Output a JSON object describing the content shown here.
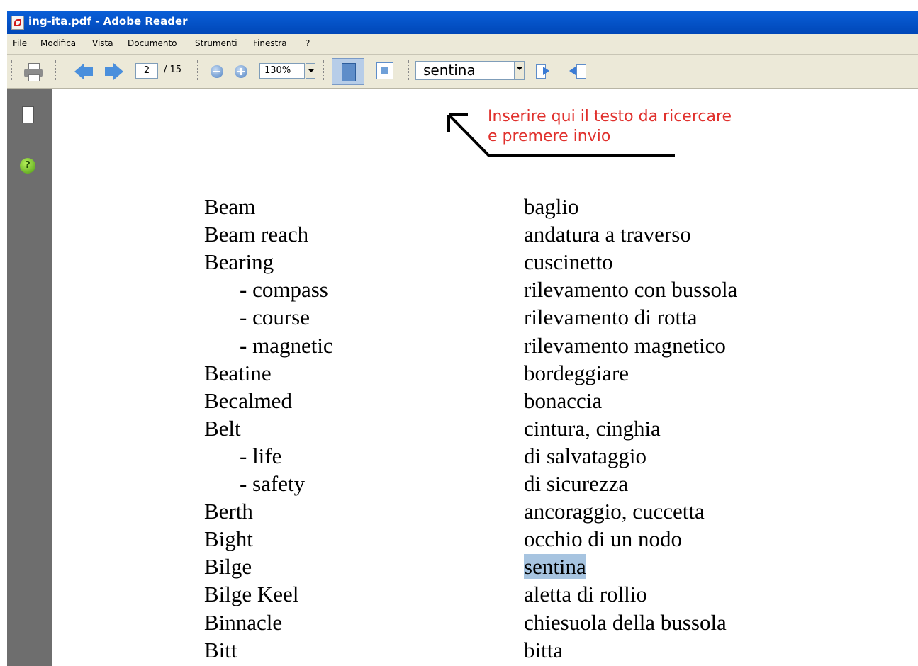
{
  "window": {
    "title": "ing-ita.pdf - Adobe Reader"
  },
  "menu": [
    "File",
    "Modifica",
    "Vista",
    "Documento",
    "Strumenti",
    "Finestra",
    "?"
  ],
  "toolbar": {
    "page_current": "2",
    "page_total": "/ 15",
    "zoom": "130%",
    "search_value": "sentina"
  },
  "icons": [
    "print-icon",
    "previous-page-icon",
    "next-page-icon",
    "zoom-out-icon",
    "zoom-in-icon",
    "fit-page-icon",
    "fit-window-icon",
    "find-previous-icon",
    "find-next-icon",
    "pages-icon",
    "help-icon"
  ],
  "annotation": {
    "line1": "Inserire qui il testo da ricercare",
    "line2": "e premere invio",
    "color": "#e0302c"
  },
  "highlight_color": "#a7c4e0",
  "glossary": [
    {
      "term": "Beam",
      "translation": "baglio"
    },
    {
      "term": "Beam reach",
      "translation": "andatura a traverso"
    },
    {
      "term": "Bearing",
      "translation": "cuscinetto"
    },
    {
      "term": "- compass",
      "translation": "rilevamento con bussola"
    },
    {
      "term": "- course",
      "translation": "rilevamento di rotta"
    },
    {
      "term": "- magnetic",
      "translation": "rilevamento magnetico"
    },
    {
      "term": "Beatine",
      "translation": "bordeggiare"
    },
    {
      "term": "Becalmed",
      "translation": "bonaccia"
    },
    {
      "term": "Belt",
      "translation": "cintura, cinghia"
    },
    {
      "term": "- life",
      "translation": "di salvataggio"
    },
    {
      "term": "- safety",
      "translation": "di sicurezza"
    },
    {
      "term": "Berth",
      "translation": "ancoraggio, cuccetta"
    },
    {
      "term": "Bight",
      "translation": "occhio di un nodo"
    },
    {
      "term": "Bilge",
      "translation": "sentina"
    },
    {
      "term": "Bilge Keel",
      "translation": "aletta di rollio"
    },
    {
      "term": "Binnacle",
      "translation": "chiesuola della bussola"
    },
    {
      "term": "Bitt",
      "translation": "bitta"
    }
  ]
}
